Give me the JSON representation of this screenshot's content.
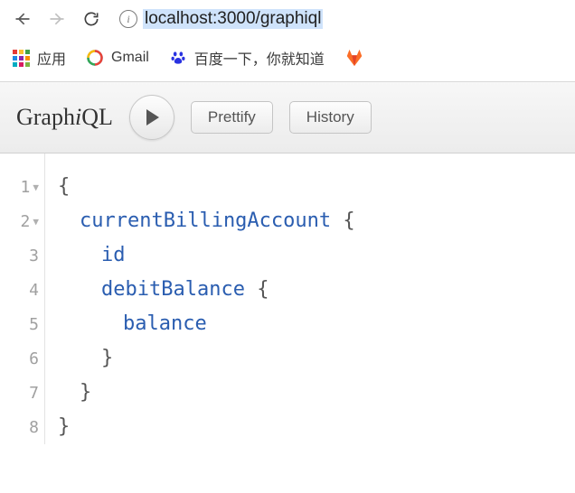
{
  "browser": {
    "url": "localhost:3000/graphiql"
  },
  "bookmarks": {
    "apps": "应用",
    "gmail": "Gmail",
    "baidu": "百度一下，你就知道"
  },
  "toolbar": {
    "logo_pre": "Graph",
    "logo_i": "i",
    "logo_post": "QL",
    "prettify": "Prettify",
    "history": "History"
  },
  "editor": {
    "lines": [
      "1",
      "2",
      "3",
      "4",
      "5",
      "6",
      "7",
      "8"
    ],
    "l1": "{",
    "l2_field": "currentBillingAccount",
    "l2_brace": " {",
    "l3": "id",
    "l4_field": "debitBalance",
    "l4_brace": " {",
    "l5": "balance",
    "l6": "}",
    "l7": "}",
    "l8": "}"
  }
}
